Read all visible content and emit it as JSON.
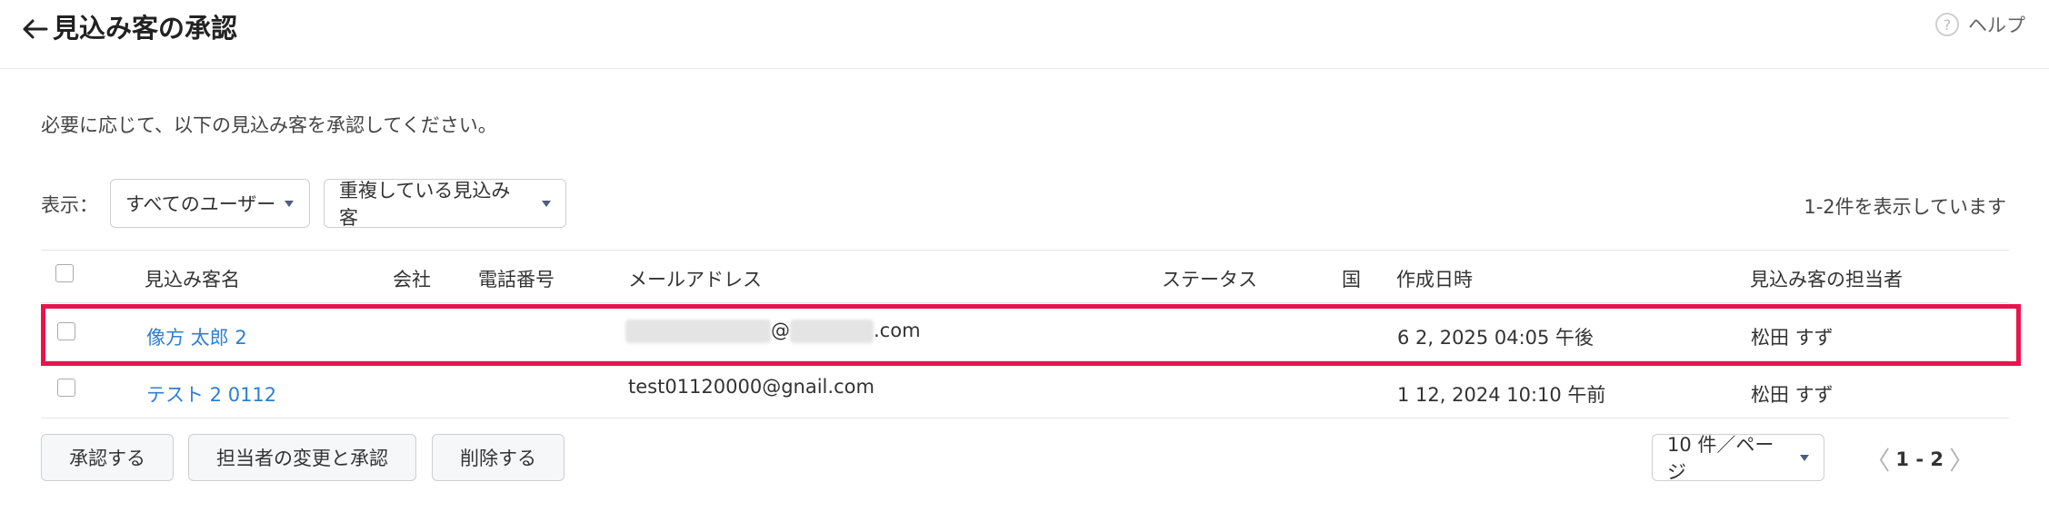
{
  "header": {
    "title": "見込み客の承認",
    "help_label": "ヘルプ",
    "help_icon": "?"
  },
  "description": "必要に応じて、以下の見込み客を承認してください。",
  "filters": {
    "label": "表示：",
    "user_filter": "すべてのユーザー",
    "type_filter": "重複している見込み客"
  },
  "result_count": "1-2件を表示しています",
  "table": {
    "columns": [
      "見込み客名",
      "会社",
      "電話番号",
      "メールアドレス",
      "ステータス",
      "国",
      "作成日時",
      "見込み客の担当者"
    ],
    "rows": [
      {
        "name": "像方 太郎 2",
        "company": "",
        "phone": "",
        "email_at": "@",
        "email_suffix": ".com",
        "status": "",
        "country": "",
        "created": "6 2, 2025 04:05 午後",
        "owner": "松田 すず"
      },
      {
        "name": "テスト 2 0112",
        "company": "",
        "phone": "",
        "email": "test01120000@gnail.com",
        "status": "",
        "country": "",
        "created": "1 12, 2024 10:10 午前",
        "owner": "松田 すず"
      }
    ]
  },
  "actions": {
    "approve": "承認する",
    "change_owner_approve": "担当者の変更と承認",
    "delete": "削除する"
  },
  "pagination": {
    "per_page": "10 件／ページ",
    "range": "1 - 2",
    "prev": "〈",
    "next": "〉"
  },
  "colors": {
    "link": "#2f7fd1",
    "highlight": "#e8154d"
  }
}
